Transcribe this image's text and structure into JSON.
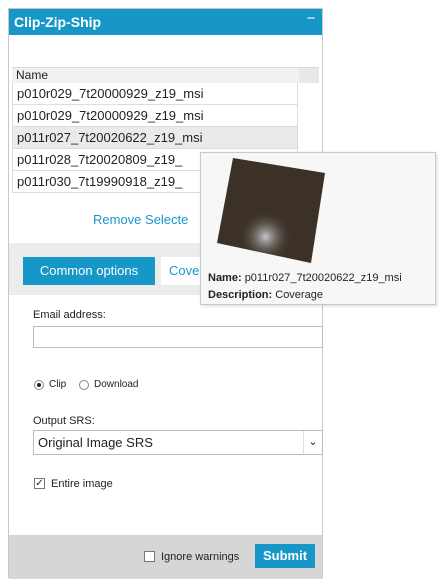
{
  "panel": {
    "title": "Clip-Zip-Ship",
    "collapse_symbol": "−"
  },
  "table": {
    "column_header": "Name",
    "rows": [
      "p010r029_7t20000929_z19_msi",
      "p010r029_7t20000929_z19_msi",
      "p011r027_7t20020622_z19_msi",
      "p011r028_7t20020809_z19_",
      "p011r030_7t19990918_z19_"
    ],
    "selected_row": 2
  },
  "remove_selected": "Remove Selecte",
  "tabs": {
    "common": "Common options",
    "coverage": "Cove"
  },
  "email": {
    "label": "Email address:",
    "value": "",
    "placeholder": ""
  },
  "mode": {
    "clip_label": "Clip",
    "download_label": "Download",
    "selected": "clip"
  },
  "srs": {
    "label": "Output SRS:",
    "value": "Original Image SRS"
  },
  "entire_image": {
    "label": "Entire image",
    "checked": true
  },
  "footer": {
    "ignore_warnings_label": "Ignore warnings",
    "ignore_warnings_checked": false,
    "submit_label": "Submit"
  },
  "tooltip": {
    "name_label": "Name:",
    "name_value": "p011r027_7t20020622_z19_msi",
    "description_label": "Description:",
    "description_value": "Coverage"
  },
  "colors": {
    "accent": "#1697c8",
    "footer_bg": "#d6d6d6",
    "tabstrip_bg": "#ececec"
  }
}
